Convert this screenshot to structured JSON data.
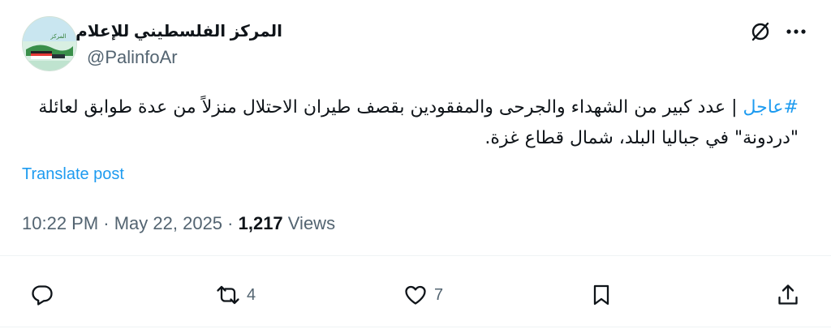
{
  "author": {
    "display_name": "المركز الفلسطيني للإعلام",
    "handle": "@PalinfoAr",
    "avatar_icon": "palinfo-logo-avatar",
    "verified": true
  },
  "post": {
    "hashtag": "#عاجل",
    "text": " | عدد كبير من الشهداء والجرحى والمفقودين بقصف طيران الاحتلال منزلاً من عدة طوابق لعائلة \"دردونة\" في جباليا البلد، شمال قطاع غزة.",
    "translate_label": "Translate post"
  },
  "meta": {
    "time": "10:22 PM",
    "separator": " · ",
    "date": "May 22, 2025",
    "separator2": " · ",
    "views_count": "1,217",
    "views_label": " Views"
  },
  "actions": {
    "reply_icon": "reply-icon",
    "repost_icon": "repost-icon",
    "repost_count": "4",
    "like_icon": "heart-icon",
    "like_count": "7",
    "bookmark_icon": "bookmark-icon",
    "share_icon": "share-icon"
  },
  "colors": {
    "accent": "#1d9bf0",
    "text": "#0f1419",
    "muted": "#536471",
    "divider": "#eff3f4"
  }
}
